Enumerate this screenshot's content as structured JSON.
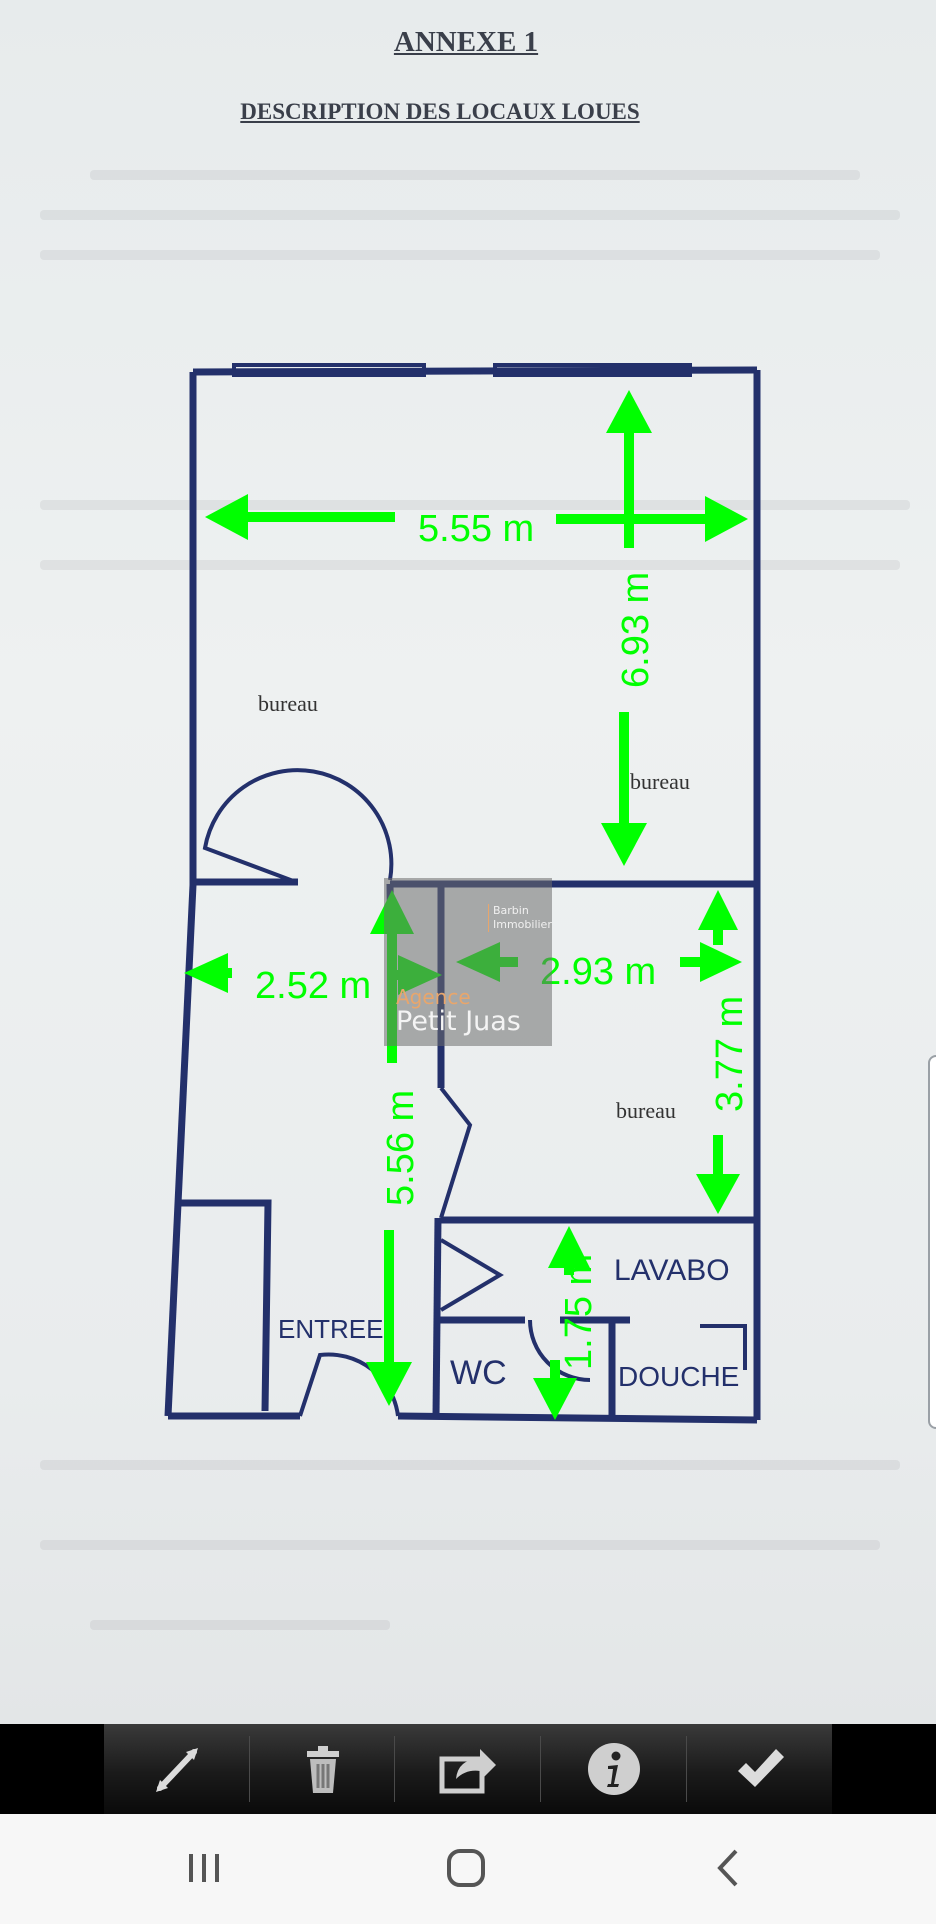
{
  "document": {
    "title": "ANNEXE 1",
    "subtitle": "DESCRIPTION DES LOCAUX LOUES"
  },
  "floor_plan": {
    "room_labels": [
      "bureau",
      "bureau",
      "bureau",
      "ENTREE",
      "WC",
      "LAVABO",
      "DOUCHE"
    ],
    "measurements": [
      "5.55 m",
      "6.93 m",
      "2.52 m",
      "2.93 m",
      "3.77 m",
      "5.56 m",
      "1.75 m"
    ]
  },
  "watermark": {
    "brand_line1": "Barbin",
    "brand_line2": "Immobilier",
    "agency_prefix": "Agence",
    "agency_name": "Petit Juas"
  },
  "toolbar": {
    "buttons": [
      {
        "icon": "measure-line-icon"
      },
      {
        "icon": "trash-icon"
      },
      {
        "icon": "share-icon"
      },
      {
        "icon": "info-icon"
      },
      {
        "icon": "check-icon"
      }
    ]
  },
  "navbar": {
    "buttons": [
      {
        "icon": "recent-apps-icon"
      },
      {
        "icon": "home-icon"
      },
      {
        "icon": "back-icon"
      }
    ]
  },
  "colors": {
    "measure": "#00ff00",
    "plan_lines": "#23306b",
    "toolbar": "#1a1a1a"
  }
}
